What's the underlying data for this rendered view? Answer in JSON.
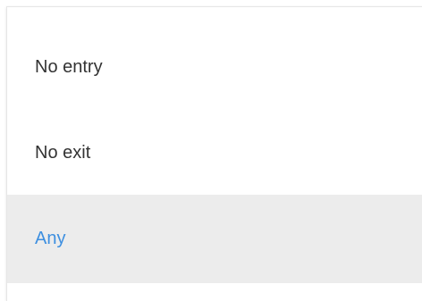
{
  "dropdown": {
    "items": [
      {
        "label": "No entry",
        "selected": false
      },
      {
        "label": "No exit",
        "selected": false
      },
      {
        "label": "Any",
        "selected": true
      }
    ]
  },
  "colors": {
    "selected_text": "#3d8fe0",
    "selected_background": "#ececec",
    "text": "#333333"
  }
}
